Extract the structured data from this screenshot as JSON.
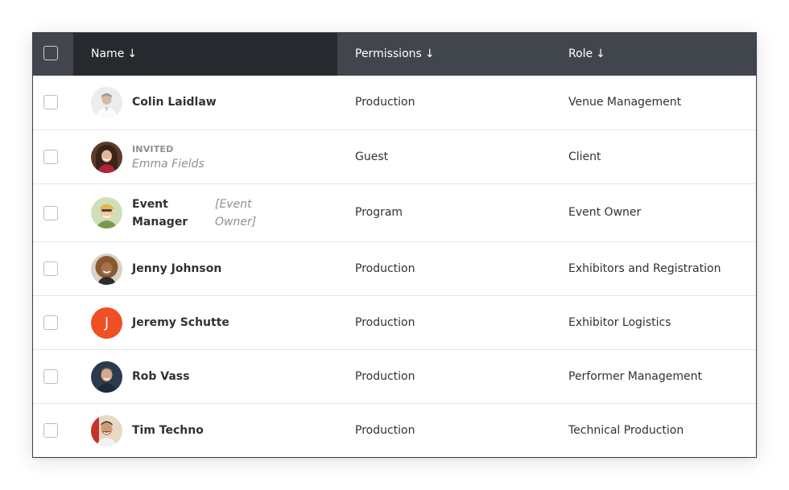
{
  "header": {
    "name_label": "Name",
    "permissions_label": "Permissions",
    "role_label": "Role",
    "sort_arrow": "↓"
  },
  "rows": [
    {
      "name": "Colin Laidlaw",
      "permission": "Production",
      "role": "Venue Management",
      "avatar": "photo"
    },
    {
      "status": "INVITED",
      "name": "Emma Fields",
      "permission": "Guest",
      "role": "Client",
      "avatar": "photo"
    },
    {
      "name_line1": "Event",
      "name_line2": "Manager",
      "tag_line1": "[Event",
      "tag_line2": "Owner]",
      "permission": "Program",
      "role": "Event Owner",
      "avatar": "photo"
    },
    {
      "name": "Jenny Johnson",
      "permission": "Production",
      "role": "Exhibitors and Registration",
      "avatar": "photo"
    },
    {
      "name": "Jeremy Schutte",
      "initial": "J",
      "permission": "Production",
      "role": "Exhibitor Logistics",
      "avatar": "initial"
    },
    {
      "name": "Rob Vass",
      "permission": "Production",
      "role": "Performer Management",
      "avatar": "photo"
    },
    {
      "name": "Tim Techno",
      "permission": "Production",
      "role": "Technical Production",
      "avatar": "photo"
    }
  ],
  "colors": {
    "header_bg": "#41464d",
    "header_sorted_bg": "#26292d",
    "initial_avatar_bg": "#f04e23"
  }
}
